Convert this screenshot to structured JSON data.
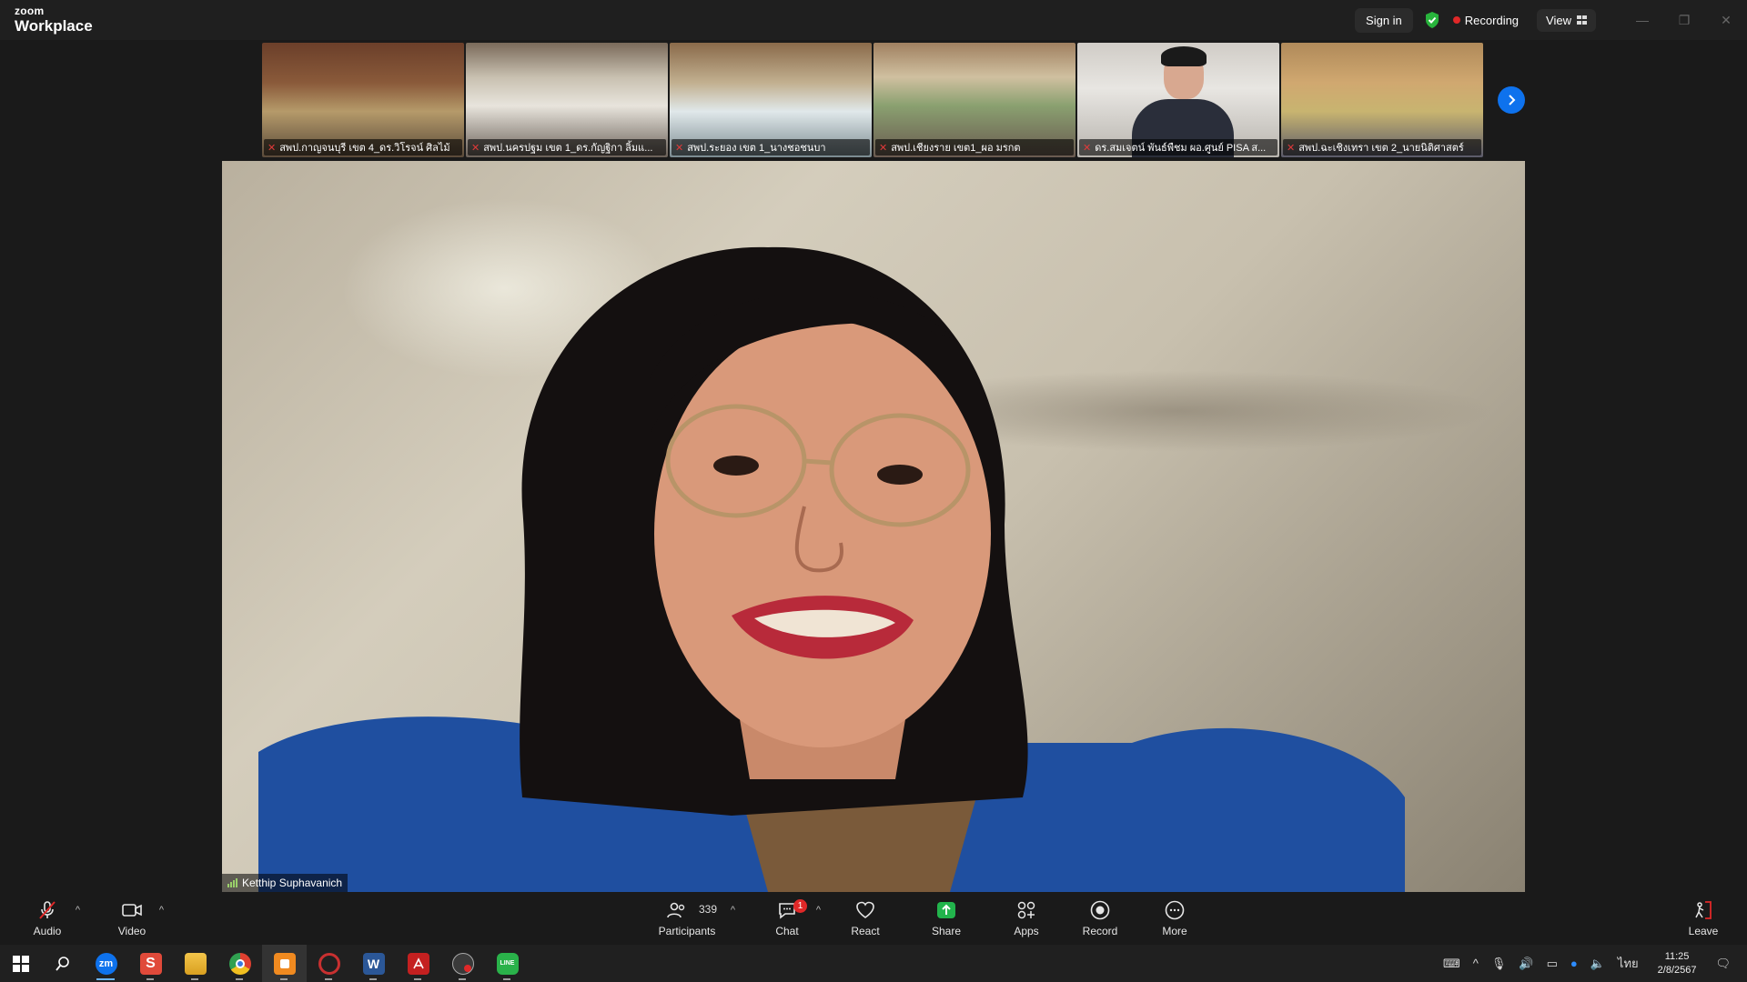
{
  "titlebar": {
    "logo_small": "zoom",
    "logo_big": "Workplace",
    "signin": "Sign in",
    "recording": "Recording",
    "view": "View",
    "minimize": "—",
    "maximize": "❐",
    "close": "✕"
  },
  "thumbnails": [
    {
      "name": "สพป.กาญจนบุรี เขต 4_ดร.วิโรจน์ ศิลไม้"
    },
    {
      "name": "สพป.นครปฐม เขต 1_ดร.กัญฐิกา ลิ้มแ..."
    },
    {
      "name": "สพป.ระยอง เขต 1_นางชอชนบา"
    },
    {
      "name": "สพป.เชียงราย เขต1_ผอ มรกต"
    },
    {
      "name": "ดร.สมเจตน์ พันธ์พืชม ผอ.ศูนย์ PISA ส..."
    },
    {
      "name": "สพป.ฉะเชิงเทรา เขต 2_นายนิติศาสตร์"
    }
  ],
  "main_video": {
    "speaker": "Ketthip Suphavanich"
  },
  "toolbar": {
    "audio": "Audio",
    "video": "Video",
    "participants": "Participants",
    "participant_count": "339",
    "chat": "Chat",
    "chat_badge": "1",
    "react": "React",
    "share": "Share",
    "apps": "Apps",
    "record": "Record",
    "more": "More",
    "leave": "Leave"
  },
  "taskbar": {
    "apps": [
      {
        "name": "zoom",
        "label": "zm",
        "color": "#0e72ed"
      },
      {
        "name": "s-app",
        "label": "S",
        "color": "#e04a3a"
      },
      {
        "name": "file-explorer",
        "label": "",
        "color": "#e8b430"
      },
      {
        "name": "chrome",
        "label": "",
        "color": "#3a9a4a"
      },
      {
        "name": "orange-app",
        "label": "",
        "color": "#f08a20"
      },
      {
        "name": "red-circle-app",
        "label": "",
        "color": "#c83030"
      },
      {
        "name": "word",
        "label": "W",
        "color": "#2b5797"
      },
      {
        "name": "acrobat",
        "label": "",
        "color": "#c42020"
      },
      {
        "name": "obs",
        "label": "",
        "color": "#3a3a3a"
      },
      {
        "name": "line",
        "label": "LINE",
        "color": "#2ab24a"
      }
    ],
    "lang": "ไทย",
    "time": "11:25",
    "date": "2/8/2567"
  }
}
